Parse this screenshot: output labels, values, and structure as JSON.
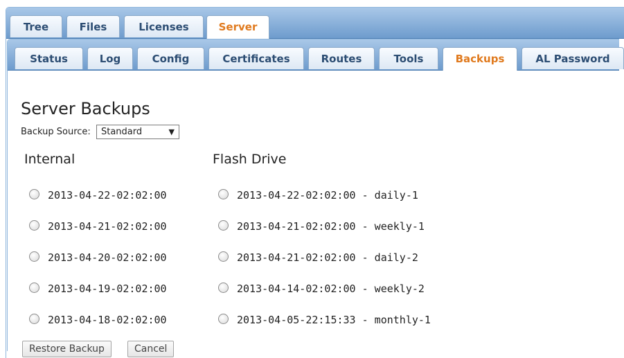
{
  "top_tabs": [
    {
      "label": "Tree",
      "active": false
    },
    {
      "label": "Files",
      "active": false
    },
    {
      "label": "Licenses",
      "active": false
    },
    {
      "label": "Server",
      "active": true
    }
  ],
  "server_tabs": [
    {
      "label": "Status",
      "active": false
    },
    {
      "label": "Log",
      "active": false
    },
    {
      "label": "Config",
      "active": false
    },
    {
      "label": "Certificates",
      "active": false
    },
    {
      "label": "Routes",
      "active": false
    },
    {
      "label": "Tools",
      "active": false
    },
    {
      "label": "Backups",
      "active": true
    },
    {
      "label": "AL Password",
      "active": false
    }
  ],
  "page": {
    "title": "Server Backups",
    "source_label": "Backup Source:",
    "source_value": "Standard"
  },
  "internal": {
    "heading": "Internal",
    "items": [
      "2013-04-22-02:02:00",
      "2013-04-21-02:02:00",
      "2013-04-20-02:02:00",
      "2013-04-19-02:02:00",
      "2013-04-18-02:02:00"
    ]
  },
  "flash": {
    "heading": "Flash Drive",
    "items": [
      "2013-04-22-02:02:00 - daily-1",
      "2013-04-21-02:02:00 - weekly-1",
      "2013-04-21-02:02:00 - daily-2",
      "2013-04-14-02:02:00 - weekly-2",
      "2013-04-05-22:15:33 - monthly-1"
    ]
  },
  "buttons": {
    "restore": "Restore Backup",
    "cancel": "Cancel"
  },
  "colors": {
    "active_tab": "#e07a1e",
    "tab_text": "#2c4d73",
    "tab_bar": "#6e9ccd"
  }
}
